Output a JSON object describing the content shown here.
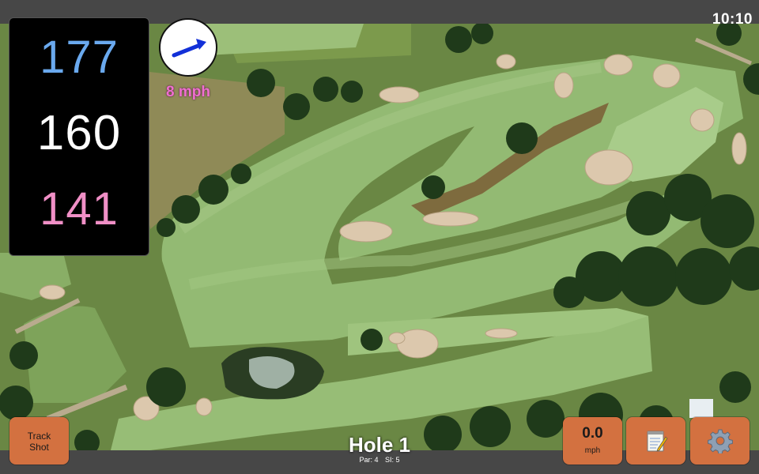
{
  "clock": "10:10",
  "distances": {
    "back": "177",
    "center": "160",
    "front": "141",
    "colors": {
      "back": "#6aa9ee",
      "center": "#ffffff",
      "front": "#f08fc6"
    }
  },
  "wind": {
    "speed_label": "8 mph",
    "direction_icon": "arrow-icon",
    "arrow_color": "#1230d8"
  },
  "hole": {
    "title": "Hole 1",
    "par_label": "Par: 4",
    "si_label": "SI: 5"
  },
  "buttons": {
    "track_shot_line1": "Track",
    "track_shot_line2": "Shot",
    "speed_value": "0.0",
    "speed_unit": "mph",
    "notes_icon": "notepad-icon",
    "settings_icon": "gear-icon",
    "accent_color": "#d37140"
  },
  "map": {
    "fairway_color": "#8fb872",
    "rough_color": "#5f7e3c",
    "bunker_color": "#dcc8ad",
    "tree_color": "#1f3a1a"
  }
}
